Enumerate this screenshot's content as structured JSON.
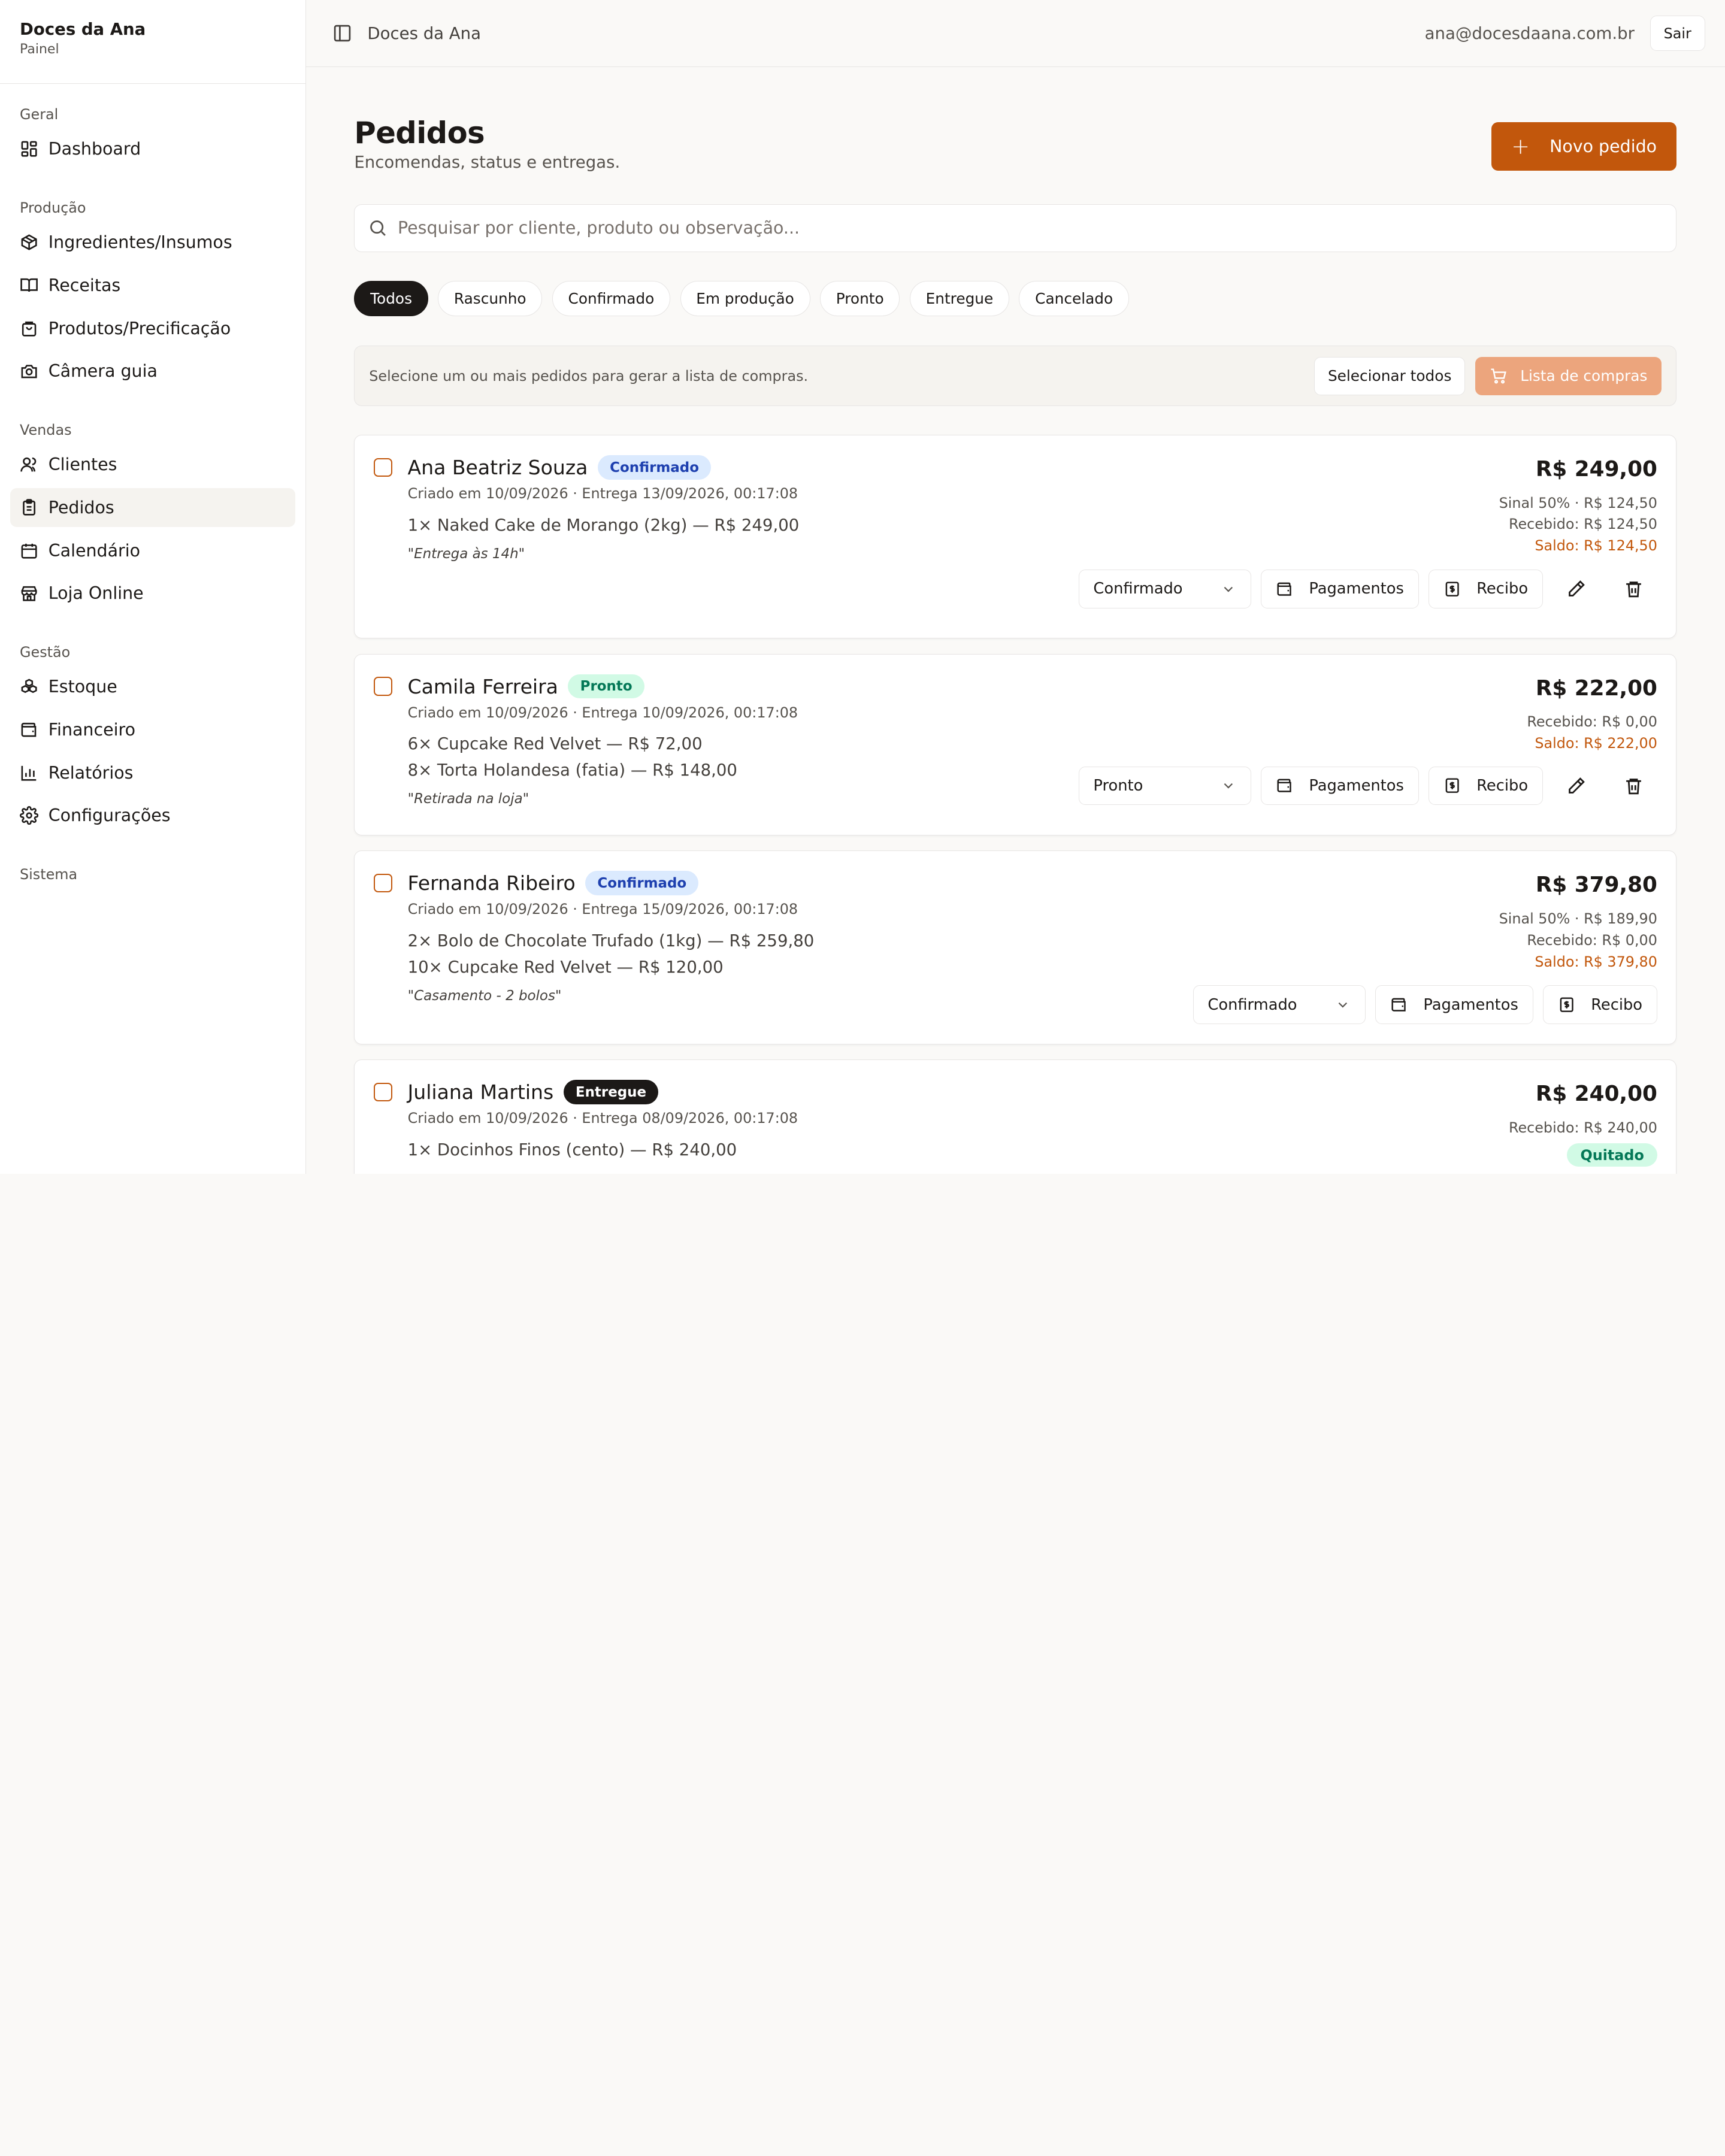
{
  "brand": {
    "name": "Doces da Ana",
    "subtitle": "Painel"
  },
  "sidebar": {
    "groups": [
      {
        "label": "Geral",
        "items": [
          {
            "label": "Dashboard",
            "icon": "dashboard-icon"
          }
        ]
      },
      {
        "label": "Produção",
        "items": [
          {
            "label": "Ingredientes/Insumos",
            "icon": "package-icon"
          },
          {
            "label": "Receitas",
            "icon": "book-icon"
          },
          {
            "label": "Produtos/Precificação",
            "icon": "shopping-bag-icon"
          },
          {
            "label": "Câmera guia",
            "icon": "camera-icon"
          }
        ]
      },
      {
        "label": "Vendas",
        "items": [
          {
            "label": "Clientes",
            "icon": "users-icon"
          },
          {
            "label": "Pedidos",
            "icon": "clipboard-icon",
            "active": true
          },
          {
            "label": "Calendário",
            "icon": "calendar-icon"
          },
          {
            "label": "Loja Online",
            "icon": "store-icon"
          }
        ]
      },
      {
        "label": "Gestão",
        "items": [
          {
            "label": "Estoque",
            "icon": "boxes-icon"
          },
          {
            "label": "Financeiro",
            "icon": "wallet-icon"
          },
          {
            "label": "Relatórios",
            "icon": "bar-chart-icon"
          },
          {
            "label": "Configurações",
            "icon": "gear-icon"
          }
        ]
      },
      {
        "label": "Sistema",
        "items": []
      }
    ]
  },
  "topbar": {
    "breadcrumb": "Doces da Ana",
    "email": "ana@docesdaana.com.br",
    "logout": "Sair"
  },
  "page": {
    "title": "Pedidos",
    "subtitle": "Encomendas, status e entregas.",
    "new_order": "Novo pedido",
    "search_placeholder": "Pesquisar por cliente, produto ou observação...",
    "filters": [
      "Todos",
      "Rascunho",
      "Confirmado",
      "Em produção",
      "Pronto",
      "Entregue",
      "Cancelado"
    ],
    "active_filter": "Todos",
    "shopping": {
      "message": "Selecione um ou mais pedidos para gerar a lista de compras.",
      "select_all": "Selecionar todos",
      "list_button": "Lista de compras"
    }
  },
  "labels": {
    "payments": "Pagamentos",
    "receipt": "Recibo"
  },
  "orders": [
    {
      "client": "Ana Beatriz Souza",
      "status": "Confirmado",
      "status_kind": "conf",
      "meta": "Criado em 10/09/2026 · Entrega 13/09/2026, 00:17:08",
      "items": [
        "1× Naked Cake de Morango (2kg) — R$ 249,00"
      ],
      "note": "\"Entrega às 14h\"",
      "total": "R$ 249,00",
      "lines": [
        "Sinal 50% · R$ 124,50",
        "Recebido: R$ 124,50"
      ],
      "saldo": "Saldo: R$ 124,50",
      "select_value": "Confirmado"
    },
    {
      "client": "Camila Ferreira",
      "status": "Pronto",
      "status_kind": "pronto",
      "meta": "Criado em 10/09/2026 · Entrega 10/09/2026, 00:17:08",
      "items": [
        "6× Cupcake Red Velvet — R$ 72,00",
        "8× Torta Holandesa (fatia) — R$ 148,00"
      ],
      "note": "\"Retirada na loja\"",
      "total": "R$ 222,00",
      "lines": [
        "Recebido: R$ 0,00"
      ],
      "saldo": "Saldo: R$ 222,00",
      "select_value": "Pronto"
    },
    {
      "client": "Fernanda Ribeiro",
      "status": "Confirmado",
      "status_kind": "conf",
      "meta": "Criado em 10/09/2026 · Entrega 15/09/2026, 00:17:08",
      "items": [
        "2× Bolo de Chocolate Trufado (1kg) — R$ 259,80",
        "10× Cupcake Red Velvet — R$ 120,00"
      ],
      "note": "\"Casamento - 2 bolos\"",
      "total": "R$ 379,80",
      "lines": [
        "Sinal 50% · R$ 189,90",
        "Recebido: R$ 0,00"
      ],
      "saldo": "Saldo: R$ 379,80",
      "select_value": "Confirmado"
    },
    {
      "client": "Juliana Martins",
      "status": "Entregue",
      "status_kind": "entregue",
      "meta": "Criado em 10/09/2026 · Entrega 08/09/2026, 00:17:08",
      "items": [
        "1× Docinhos Finos (cento) — R$ 240,00"
      ],
      "total": "R$ 240,00",
      "lines": [
        "Recebido: R$ 240,00"
      ],
      "paid_badge": "Quitado"
    }
  ],
  "colors": {
    "accent": "#c2570c",
    "accent_light": "#eca57d",
    "confirmed_bg": "#dbeafe",
    "ready_bg": "#d1fae5",
    "delivered_bg": "#1c1917"
  }
}
